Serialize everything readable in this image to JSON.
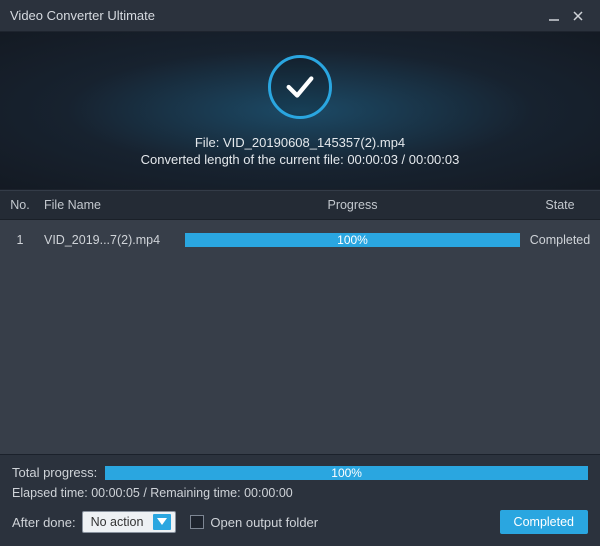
{
  "window": {
    "title": "Video Converter Ultimate"
  },
  "hero": {
    "file_line": "File: VID_20190608_145357(2).mp4",
    "length_line": "Converted length of the current file: 00:00:03 / 00:00:03"
  },
  "table": {
    "headers": {
      "no": "No.",
      "name": "File Name",
      "progress": "Progress",
      "state": "State"
    },
    "rows": [
      {
        "no": "1",
        "name": "VID_2019...7(2).mp4",
        "progress_pct": "100%",
        "state": "Completed"
      }
    ]
  },
  "footer": {
    "total_label": "Total progress:",
    "total_pct": "100%",
    "time_line": "Elapsed time: 00:00:05 / Remaining time: 00:00:00",
    "after_done_label": "After done:",
    "after_done_value": "No action",
    "open_folder_label": "Open output folder",
    "completed_button": "Completed"
  }
}
